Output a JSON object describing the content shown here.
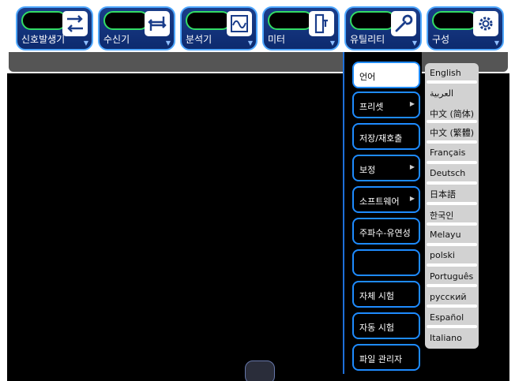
{
  "toolbar": {
    "tabs": [
      {
        "label": "신호발생기",
        "icon": "signal-generator-icon"
      },
      {
        "label": "수신기",
        "icon": "receiver-icon"
      },
      {
        "label": "분석기",
        "icon": "analyzer-icon"
      },
      {
        "label": "미터",
        "icon": "meter-icon"
      },
      {
        "label": "유틸리티",
        "icon": "wrench-icon"
      },
      {
        "label": "구성",
        "icon": "gear-icon"
      }
    ],
    "dropdown_glyph": "▼"
  },
  "utility_menu": {
    "items": [
      {
        "label": "언어",
        "has_submenu": false,
        "active": true
      },
      {
        "label": "프리셋",
        "has_submenu": true
      },
      {
        "label": "저장/재호출",
        "has_submenu": false
      },
      {
        "label": "보정",
        "has_submenu": true
      },
      {
        "label": "소프트웨어",
        "has_submenu": true
      },
      {
        "label": "주파수-유연성",
        "has_submenu": false
      },
      {
        "label": "",
        "has_submenu": false
      },
      {
        "label": "자체 시험",
        "has_submenu": false
      },
      {
        "label": "자동 시험",
        "has_submenu": false
      },
      {
        "label": "파일 관리자",
        "has_submenu": false
      }
    ],
    "submenu_glyph": "▶"
  },
  "language_menu": {
    "items": [
      "English",
      "العربية",
      "中文 (简体)",
      "中文 (繁體)",
      "Français",
      "Deutsch",
      "日本語",
      "한국인",
      "Melayu",
      "polski",
      "Português",
      "русский",
      "Español",
      "Italiano"
    ]
  },
  "colors": {
    "tab_fill": "#1a3d8a",
    "tab_border": "#4fa8ff",
    "pill_border": "#33dd66",
    "menu_border": "#1e8bff",
    "display_bg": "#000000",
    "lang_panel_bg": "#d2d2d2"
  }
}
